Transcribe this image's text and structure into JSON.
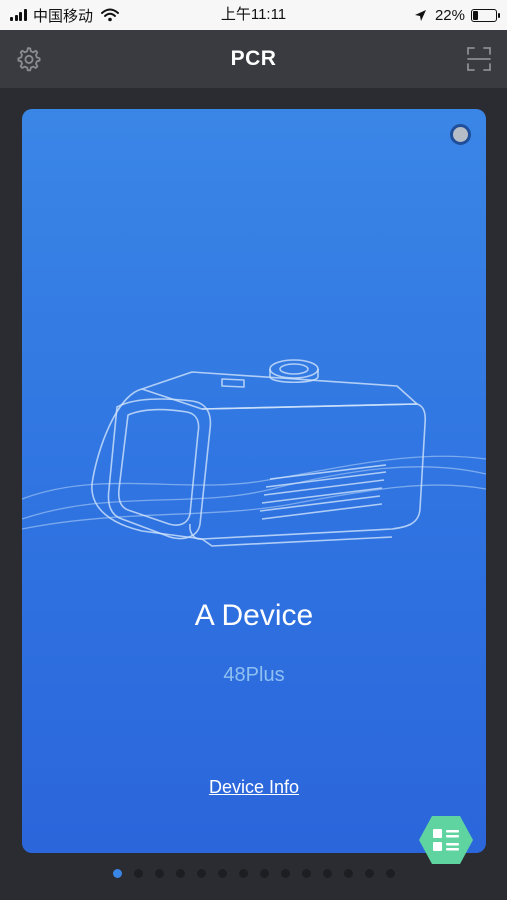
{
  "status_bar": {
    "carrier": "中国移动",
    "time": "上午11:11",
    "battery_percent_text": "22%",
    "battery_level": 0.22
  },
  "nav": {
    "title": "PCR",
    "left_icon": "gear-icon",
    "right_icon": "scan-icon"
  },
  "device_card": {
    "name": "A Device",
    "model": "48Plus",
    "info_link": "Device Info"
  },
  "fab": {
    "icon": "list-icon",
    "color": "#5fd3a0"
  },
  "pager": {
    "count": 14,
    "active_index": 0
  },
  "colors": {
    "card_blue": "#3a86e6",
    "nav_bg": "#3a3b40",
    "model_text": "#8ec0f2"
  }
}
